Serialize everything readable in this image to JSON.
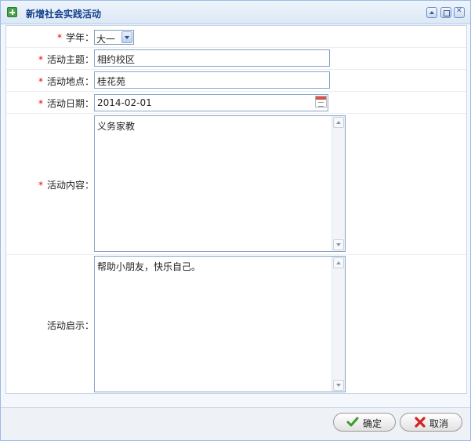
{
  "dialog": {
    "title": "新增社会实践活动"
  },
  "form": {
    "required_mark": "*",
    "grade": {
      "label": "学年：",
      "value": "大一"
    },
    "topic": {
      "label": "活动主题：",
      "value": "相约校区"
    },
    "location": {
      "label": "活动地点：",
      "value": "桂花苑"
    },
    "date": {
      "label": "活动日期：",
      "value": "2014-02-01"
    },
    "content": {
      "label": "活动内容：",
      "value": "义务家教"
    },
    "insight": {
      "label": "活动启示：",
      "value": "帮助小朋友，快乐自己。"
    }
  },
  "footer": {
    "ok_label": "确定",
    "cancel_label": "取消"
  },
  "colors": {
    "title_text": "#15428b",
    "required": "#ee0000",
    "field_border": "#8aa3c7"
  }
}
